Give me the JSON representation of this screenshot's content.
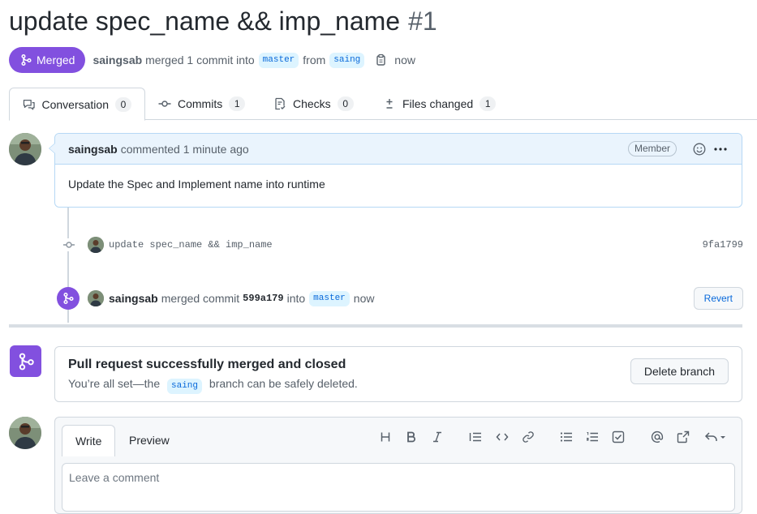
{
  "pr": {
    "title": "update spec_name && imp_name",
    "number": "#1",
    "state": "Merged",
    "author": "saingsab",
    "merge_text": "merged 1 commit into",
    "base_branch": "master",
    "from_text": "from",
    "head_branch": "saing",
    "time": "now"
  },
  "tabs": [
    {
      "label": "Conversation",
      "count": "0",
      "icon": "comment-discussion-icon"
    },
    {
      "label": "Commits",
      "count": "1",
      "icon": "git-commit-icon"
    },
    {
      "label": "Checks",
      "count": "0",
      "icon": "checklist-icon"
    },
    {
      "label": "Files changed",
      "count": "1",
      "icon": "diff-icon"
    }
  ],
  "comment": {
    "author": "saingsab",
    "action": "commented 1 minute ago",
    "role": "Member",
    "body": "Update the Spec and Implement name into runtime"
  },
  "commit": {
    "message": "update spec_name && imp_name",
    "sha": "9fa1799"
  },
  "merge_event": {
    "author": "saingsab",
    "text": "merged commit",
    "sha": "599a179",
    "into": "into",
    "branch": "master",
    "time": "now",
    "revert_label": "Revert"
  },
  "merged_box": {
    "title": "Pull request successfully merged and closed",
    "sub_before": "You’re all set—the",
    "branch": "saing",
    "sub_after": "branch can be safely deleted.",
    "delete_label": "Delete branch"
  },
  "editor": {
    "write_tab": "Write",
    "preview_tab": "Preview",
    "placeholder": "Leave a comment"
  },
  "colors": {
    "merged": "#8250df",
    "link": "#0969da",
    "branch_bg": "#ddf4ff"
  }
}
